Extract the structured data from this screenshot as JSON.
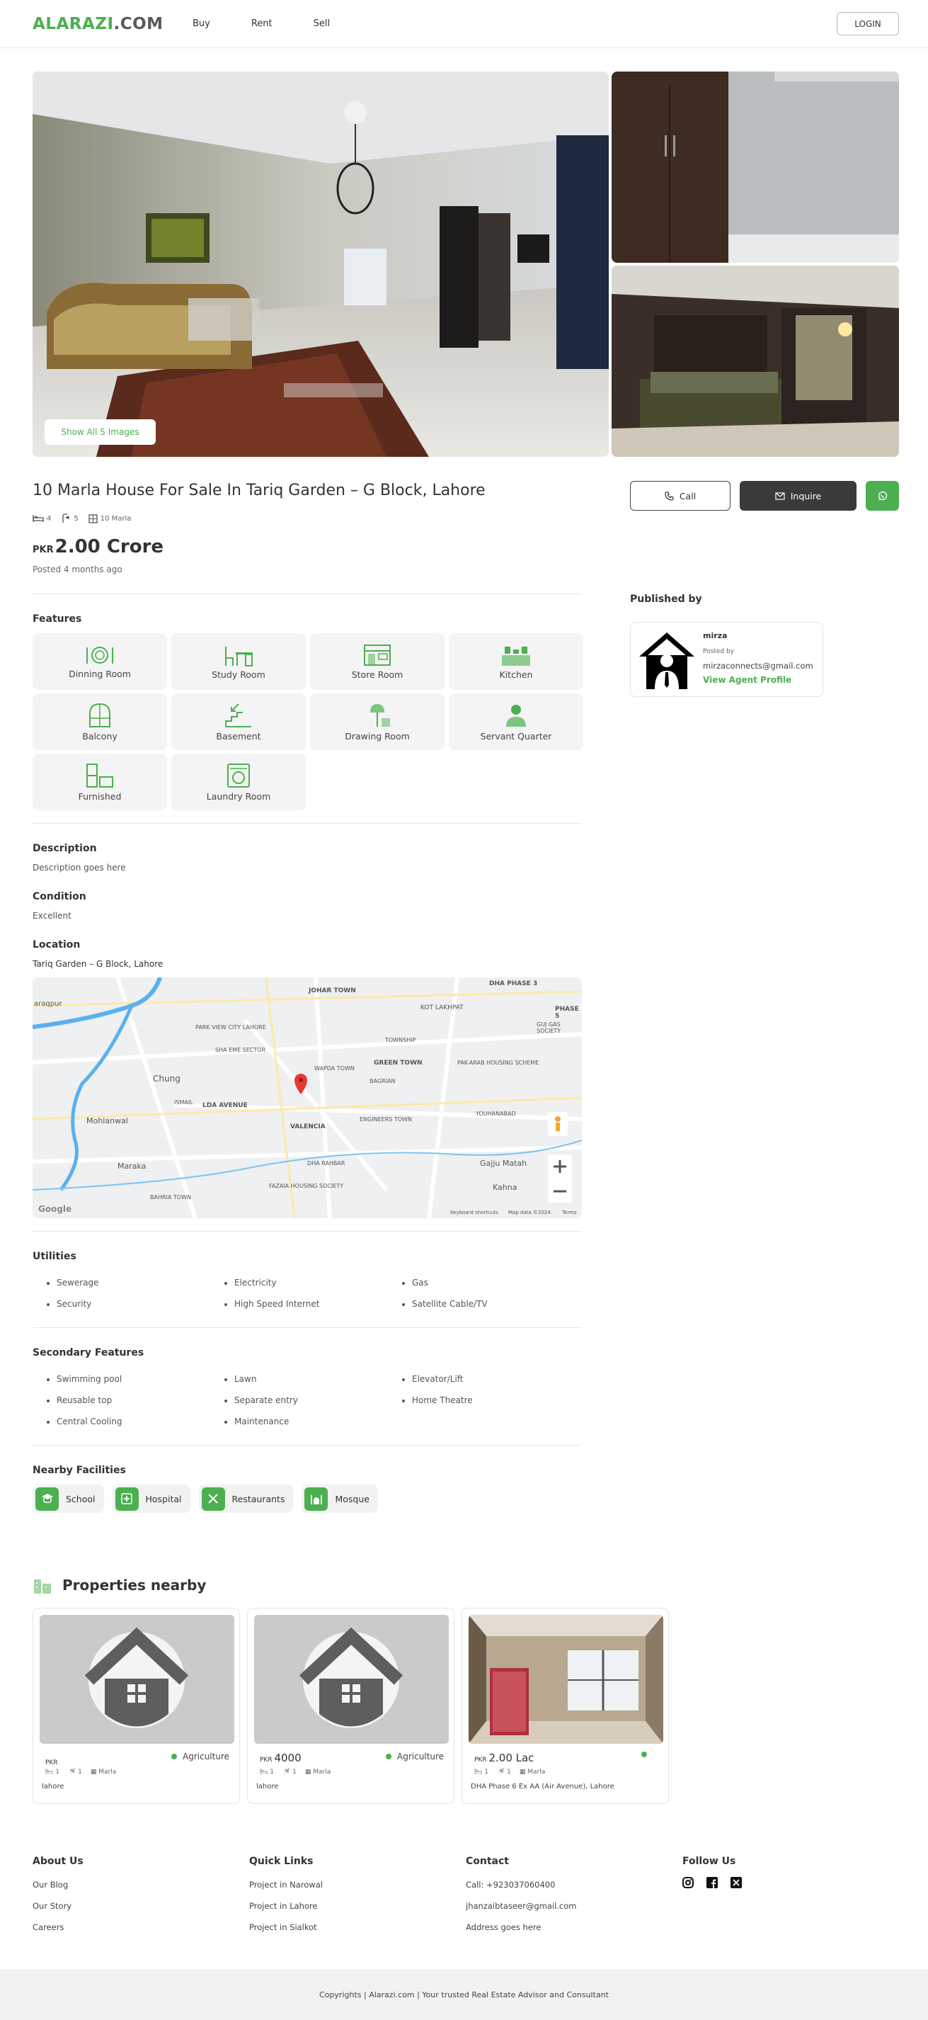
{
  "header": {
    "logo_main": "ALARAZI",
    "logo_suffix": ".COM",
    "nav": [
      "Buy",
      "Rent",
      "Sell"
    ],
    "login": "LOGIN"
  },
  "gallery": {
    "show_all": "Show All 5 Images"
  },
  "listing": {
    "title": "10 Marla House For Sale In Tariq Garden – G Block, Lahore",
    "beds": "4",
    "baths": "5",
    "area": "10 Marla",
    "currency": "PKR",
    "price": "2.00 Crore",
    "posted": "Posted 4 months ago"
  },
  "actions": {
    "call": "Call",
    "inquire": "Inquire"
  },
  "publisher": {
    "heading": "Published by",
    "name": "mirza",
    "posted_by": "Posted by",
    "email": "mirzaconnects@gmail.com",
    "profile_link": "View Agent Profile"
  },
  "features": {
    "heading": "Features",
    "items": [
      "Dinning Room",
      "Study Room",
      "Store Room",
      "Kitchen",
      "Balcony",
      "Basement",
      "Drawing Room",
      "Servant Quarter",
      "Furnished",
      "Laundry Room"
    ]
  },
  "description": {
    "heading": "Description",
    "text": "Description goes here"
  },
  "condition": {
    "heading": "Condition",
    "text": "Excellent"
  },
  "location": {
    "heading": "Location",
    "text": "Tariq Garden – G Block, Lahore"
  },
  "map": {
    "labels": [
      "JOHAR TOWN",
      "DHA PHASE 3",
      "KOT LAKHPAT",
      "PARK VIEW CITY LAHORE",
      "SHA EME SECTOR",
      "TOWNSHIP",
      "GREEN TOWN",
      "PAK-ARAB HOUSING SCHEME",
      "WAPDA TOWN",
      "Chung",
      "ISMAIL",
      "LDA AVENUE",
      "VALENCIA",
      "ENGINEERS TOWN",
      "YOUHANABAD",
      "Mohlanwal",
      "Maraka",
      "DHA RAHBAR",
      "Gajju Matah",
      "Kahna",
      "FAZAIA HOUSING SOCIETY",
      "BAHRIA TOWN",
      "GUJ GAS SOCIETY",
      "PHASE 5",
      "araqpur",
      "BAGRIAN"
    ],
    "google": "Google",
    "footer": [
      "Keyboard shortcuts",
      "Map data ©2024",
      "Terms"
    ]
  },
  "utilities": {
    "heading": "Utilities",
    "items": [
      "Sewerage",
      "Electricity",
      "Gas",
      "Security",
      "High Speed Internet",
      "Satellite Cable/TV"
    ]
  },
  "secondary": {
    "heading": "Secondary Features",
    "items": [
      "Swimming pool",
      "Lawn",
      "Elevator/Lift",
      "Reusable top",
      "Separate entry",
      "Home Theatre",
      "Central Cooling",
      "Maintenance"
    ]
  },
  "nearby_facilities": {
    "heading": "Nearby Facilities",
    "items": [
      "School",
      "Hospital",
      "Restaurants",
      "Mosque"
    ]
  },
  "nearby": {
    "heading": "Properties nearby",
    "cards": [
      {
        "currency": "PKR",
        "price": "",
        "type": "Agriculture",
        "beds": "1",
        "baths": "1",
        "area": "Marla",
        "location": "lahore"
      },
      {
        "currency": "PKR",
        "price": "4000",
        "type": "Agriculture",
        "beds": "1",
        "baths": "1",
        "area": "Marla",
        "location": "lahore"
      },
      {
        "currency": "PKR",
        "price": "2.00 Lac",
        "type": "",
        "beds": "1",
        "baths": "1",
        "area": "Marla",
        "location": "DHA Phase 6 Ex AA (Air Avenue), Lahore"
      }
    ]
  },
  "footer": {
    "about": {
      "heading": "About Us",
      "links": [
        "Our Blog",
        "Our Story",
        "Careers"
      ]
    },
    "quick": {
      "heading": "Quick Links",
      "links": [
        "Project in Narowal",
        "Project in Lahore",
        "Project in Sialkot"
      ]
    },
    "contact": {
      "heading": "Contact",
      "lines": [
        "Call: +923037060400",
        "jhanzaibtaseer@gmail.com",
        "Address goes here"
      ]
    },
    "follow": {
      "heading": "Follow Us"
    },
    "copyright": "Copyrights | Alarazi.com | Your trusted Real Estate Advisor and Consultant"
  },
  "colors": {
    "accent": "#4caf50",
    "dark_button": "#3a3a3a"
  }
}
